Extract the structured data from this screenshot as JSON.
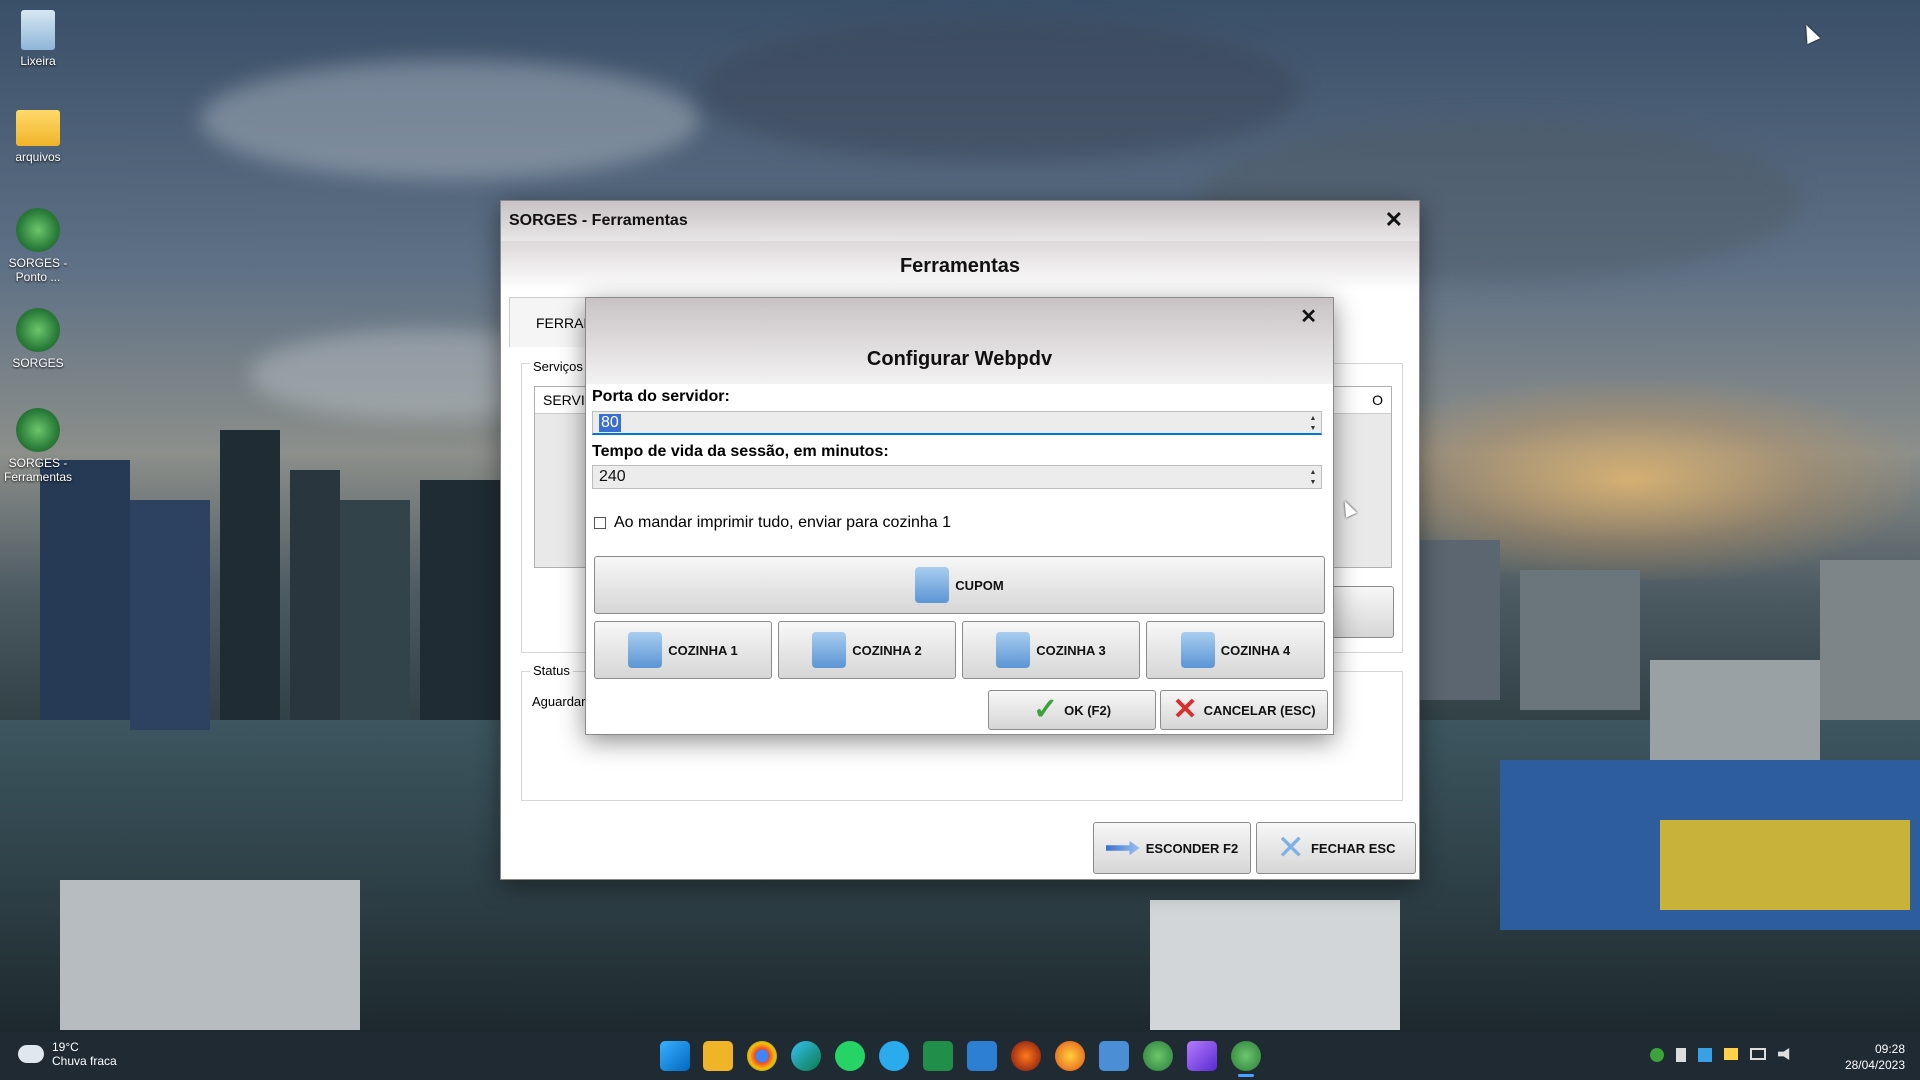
{
  "desktop": {
    "icons": [
      {
        "label": "Lixeira"
      },
      {
        "label": "arquivos"
      },
      {
        "label": "SORGES - Ponto ..."
      },
      {
        "label": "SORGES"
      },
      {
        "label": "SORGES - Ferramentas"
      }
    ]
  },
  "main_window": {
    "title": "SORGES - Ferramentas",
    "close_glyph": "✕",
    "header": "Ferramentas",
    "tab_partial": "FERRAM",
    "services_group_label": "Serviços",
    "services_col_partial": "SERVIÇ",
    "services_col_right_partial": "O",
    "status_group_label": "Status",
    "status_text_partial": "Aguardar",
    "hide_button": "ESCONDER F2",
    "close_button": "FECHAR ESC"
  },
  "dialog": {
    "close_glyph": "✕",
    "title": "Configurar Webpdv",
    "port_label": "Porta do servidor:",
    "port_value": "80",
    "session_label": "Tempo de vida da sessão, em minutos:",
    "session_value": "240",
    "checkbox_label": "Ao mandar imprimir tudo, enviar para cozinha 1",
    "checkbox_checked": false,
    "cupom_button": "CUPOM",
    "kitchen_buttons": [
      "COZINHA 1",
      "COZINHA 2",
      "COZINHA 3",
      "COZINHA 4"
    ],
    "ok_button": "OK (F2)",
    "cancel_button": "CANCELAR (ESC)"
  },
  "taskbar": {
    "weather_temp": "19°C",
    "weather_desc": "Chuva fraca",
    "time": "09:28",
    "date": "28/04/2023"
  },
  "colors": {
    "accent_blue": "#0078d7",
    "selection": "#3a6fd0",
    "ok_green": "#3aa33a",
    "cancel_red": "#d63030"
  }
}
